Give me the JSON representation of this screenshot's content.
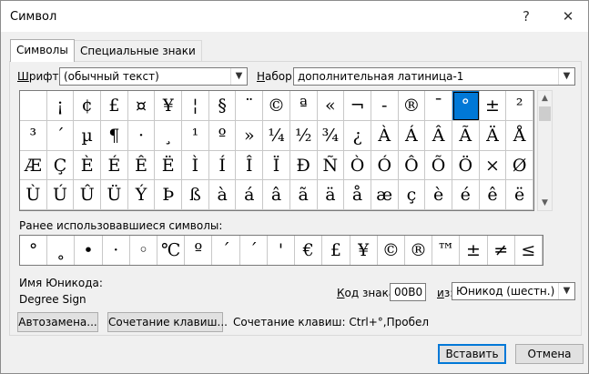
{
  "window": {
    "title": "Символ",
    "help": "?",
    "close": "✕"
  },
  "tabs": [
    "Символы",
    "Специальные знаки"
  ],
  "font": {
    "label_u": "Ш",
    "label_rest": "рифт:",
    "value": "(обычный текст)"
  },
  "subset": {
    "label_u": "Н",
    "label_rest": "абор:",
    "value": "дополнительная латиница-1"
  },
  "symbols": [
    [
      "",
      "¡",
      "¢",
      "£",
      "¤",
      "¥",
      "¦",
      "§",
      "¨",
      "©",
      "ª",
      "«",
      "¬",
      "-",
      "®",
      "¯",
      "°",
      "±",
      "²"
    ],
    [
      "³",
      "´",
      "µ",
      "¶",
      "·",
      "¸",
      "¹",
      "º",
      "»",
      "¼",
      "½",
      "¾",
      "¿",
      "À",
      "Á",
      "Â",
      "Ã",
      "Ä",
      "Å"
    ],
    [
      "Æ",
      "Ç",
      "È",
      "É",
      "Ê",
      "Ë",
      "Ì",
      "Í",
      "Î",
      "Ï",
      "Ð",
      "Ñ",
      "Ò",
      "Ó",
      "Ô",
      "Õ",
      "Ö",
      "×",
      "Ø"
    ],
    [
      "Ù",
      "Ú",
      "Û",
      "Ü",
      "Ý",
      "Þ",
      "ß",
      "à",
      "á",
      "â",
      "ã",
      "ä",
      "å",
      "æ",
      "ç",
      "è",
      "é",
      "ê",
      "ë"
    ]
  ],
  "selected_symbol": "°",
  "recent": {
    "label": "Ранее использовавшиеся символы:",
    "symbols": [
      "°",
      "˳",
      "•",
      "·",
      "◦",
      "℃",
      "º",
      "´",
      "ˊ",
      "'",
      "€",
      "£",
      "¥",
      "©",
      "®",
      "™",
      "±",
      "≠",
      "≤"
    ]
  },
  "unicode_name": {
    "label": "Имя Юникода:",
    "value": "Degree Sign"
  },
  "char_code": {
    "label_u": "К",
    "label_rest": "од знака:",
    "value": "00B0"
  },
  "from": {
    "label_u": "и",
    "label_rest": "з:",
    "value": "Юникод (шестн.)"
  },
  "buttons": {
    "autocorrect": "Автозамена...",
    "shortcut_key": "Сочетание клавиш...",
    "insert": "Вставить",
    "cancel": "Отмена"
  },
  "shortcut_text": "Сочетание клавиш: Ctrl+°,Пробел"
}
